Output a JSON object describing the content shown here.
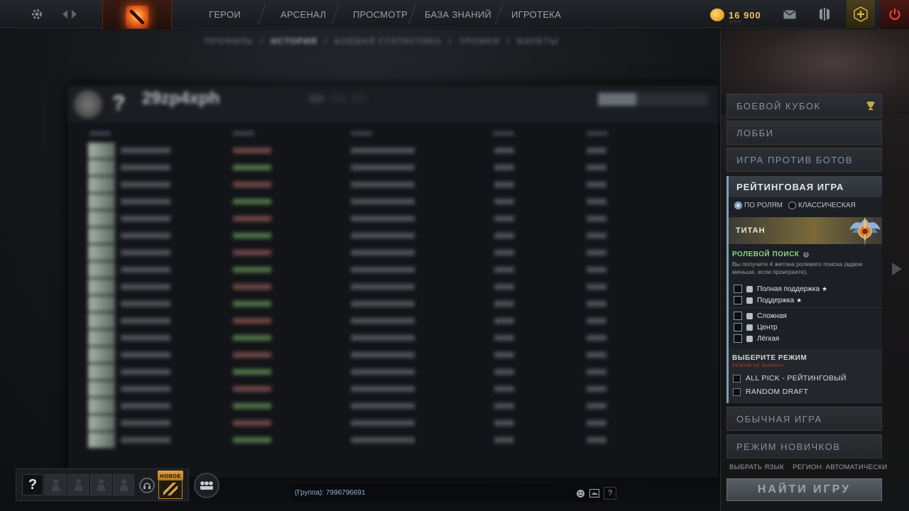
{
  "topbar": {
    "nav": [
      "ГЕРОИ",
      "АРСЕНАЛ",
      "ПРОСМОТР",
      "БАЗА ЗНАНИЙ",
      "ИГРОТЕКА"
    ],
    "gold": "16 900",
    "gold_dots": "○○○"
  },
  "subnav": {
    "items": [
      "ПРОФИЛЬ",
      "ИСТОРИЯ",
      "БОЕВАЯ СТАТИСТИКА",
      "ТРОФЕИ",
      "БИЛЕТЫ"
    ]
  },
  "profile": {
    "name": "29zp4xph"
  },
  "play": {
    "modes_top": [
      "БОЕВОЙ КУБОК",
      "ЛОББИ",
      "ИГРА ПРОТИВ БОТОВ"
    ],
    "ranked_title": "РЕЙТИНГОВАЯ ИГРА",
    "queue_roles": "ПО РОЛЯМ",
    "queue_classic": "КЛАССИЧЕСКАЯ",
    "rank": "ТИТАН",
    "role_search_title": "РОЛЕВОЙ ПОИСК",
    "role_search_desc": "Вы получите 4 жетона ролевого поиска (вдвое меньше, если проиграете).",
    "roles": [
      {
        "label": "Полная поддержка",
        "star": "★"
      },
      {
        "label": "Поддержка",
        "star": "★"
      },
      {
        "label": "Сложная",
        "star": ""
      },
      {
        "label": "Центр",
        "star": ""
      },
      {
        "label": "Лёгкая",
        "star": ""
      }
    ],
    "mode_select_title": "ВЫБЕРИТЕ РЕЖИМ",
    "mode_warning": "РЕЖИМ НЕ ВЫБРАН",
    "game_modes": [
      "ALL PICK - РЕЙТИНГОВЫЙ",
      "RANDOM DRAFT"
    ],
    "modes_bottom": [
      "ОБЫЧНАЯ ИГРА",
      "РЕЖИМ НОВИЧКОВ"
    ],
    "language_link": "ВЫБРАТЬ ЯЗЫК",
    "region_link": "РЕГИОН: АВТОМАТИЧЕСКИ",
    "find_game": "НАЙТИ ИГРУ"
  },
  "party": {
    "self_slot": "?",
    "new_badge": "НОВОЕ"
  },
  "chat": {
    "channel_text": "(Группа): 7996796691",
    "help": "?"
  },
  "colors": {
    "accent_gold": "#f0c35a",
    "ranked_accent": "#7a9fc0",
    "role_search_green": "#8fd18a",
    "warning_red": "#c03a2a",
    "power_red": "#e04630"
  },
  "icons": {
    "settings": "gear-icon",
    "back": "chevron-left-icon",
    "forward": "chevron-right-icon",
    "mail": "mail-icon",
    "armory": "armor-icon",
    "plus": "plus-icon",
    "power": "power-icon",
    "trophy": "trophy-icon",
    "voice": "headset-icon",
    "group": "group-icon",
    "emoji": "smiley-icon",
    "chat_action": "share-icon"
  }
}
